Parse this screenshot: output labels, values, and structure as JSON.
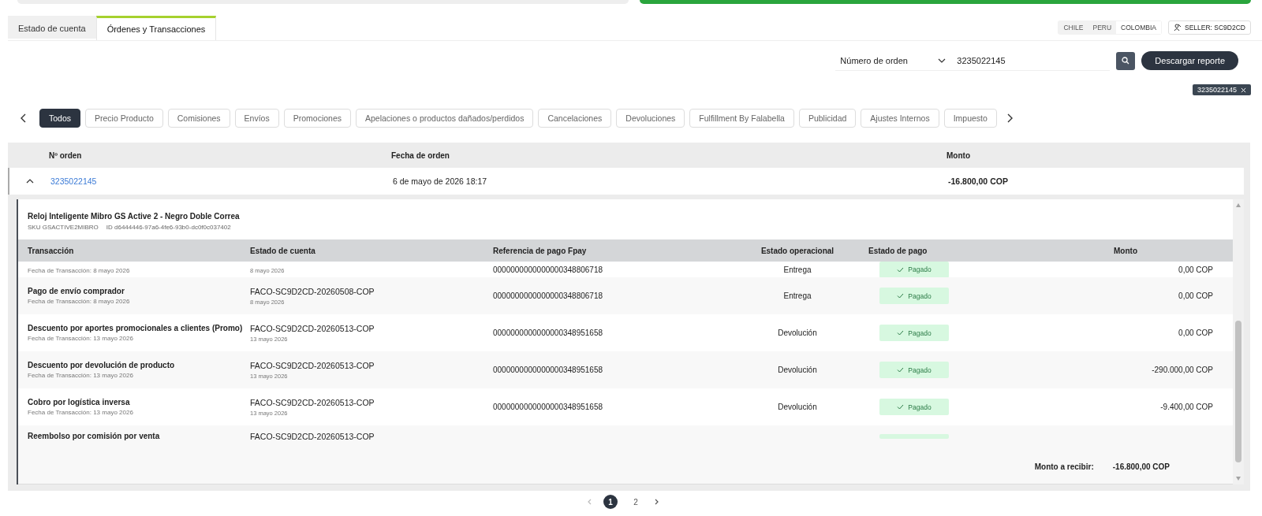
{
  "tabs": [
    {
      "label": "Estado de cuenta",
      "selected": false
    },
    {
      "label": "Órdenes y Transacciones",
      "selected": true
    }
  ],
  "countries": [
    {
      "label": "CHILE",
      "selected": false
    },
    {
      "label": "PERU",
      "selected": false
    },
    {
      "label": "COLOMBIA",
      "selected": true
    }
  ],
  "seller": "SELLER: SC9D2CD",
  "search": {
    "filter": "Número de orden",
    "value": "3235022145"
  },
  "download_button": "Descargar reporte",
  "active_filter_chip": "3235022145",
  "categories": [
    {
      "label": "Todos",
      "selected": true
    },
    {
      "label": "Precio Producto",
      "selected": false
    },
    {
      "label": "Comisiones",
      "selected": false
    },
    {
      "label": "Envíos",
      "selected": false
    },
    {
      "label": "Promociones",
      "selected": false
    },
    {
      "label": "Apelaciones o productos dañados/perdidos",
      "selected": false
    },
    {
      "label": "Cancelaciones",
      "selected": false
    },
    {
      "label": "Devoluciones",
      "selected": false
    },
    {
      "label": "Fulfillment By Falabella",
      "selected": false
    },
    {
      "label": "Publicidad",
      "selected": false
    },
    {
      "label": "Ajustes Internos",
      "selected": false
    },
    {
      "label": "Impuesto",
      "selected": false
    }
  ],
  "orders_table": {
    "columns": [
      "Nº orden",
      "Fecha de orden",
      "Monto"
    ],
    "rows": [
      {
        "order": "3235022145",
        "date": "6 de mayo de 2026 18:17",
        "amount": "-16.800,00 COP",
        "expanded": true,
        "product": {
          "name": "Reloj Inteligente Mibro GS Active 2 - Negro Doble Correa",
          "sku": "SKU GSACTIVE2MIBRO",
          "id": "ID d6444446-97a6-4fe6-93b0-dc0f0c037402"
        },
        "transactions": {
          "columns": [
            "Transacción",
            "Estado de cuenta",
            "Referencia de pago Fpay",
            "Estado operacional",
            "Estado de pago",
            "Monto"
          ],
          "rows": [
            {
              "title": "",
              "date": "Fecha de Transacción: 8 mayo 2026",
              "statement": "",
              "statement_date": "8 mayo 2026",
              "reference": "0000000000000000348806718",
              "operational": "Entrega",
              "payment": "Pagado",
              "amount": "0,00 COP"
            },
            {
              "title": "Pago de envío comprador",
              "date": "Fecha de Transacción: 8 mayo 2026",
              "statement": "FACO-SC9D2CD-20260508-COP",
              "statement_date": "8 mayo 2026",
              "reference": "0000000000000000348806718",
              "operational": "Entrega",
              "payment": "Pagado",
              "amount": "0,00 COP"
            },
            {
              "title": "Descuento por aportes promocionales a clientes (Promo)",
              "date": "Fecha de Transacción: 13 mayo 2026",
              "statement": "FACO-SC9D2CD-20260513-COP",
              "statement_date": "13 mayo 2026",
              "reference": "0000000000000000348951658",
              "operational": "Devolución",
              "payment": "Pagado",
              "amount": "0,00 COP"
            },
            {
              "title": "Descuento por devolución de producto",
              "date": "Fecha de Transacción: 13 mayo 2026",
              "statement": "FACO-SC9D2CD-20260513-COP",
              "statement_date": "13 mayo 2026",
              "reference": "0000000000000000348951658",
              "operational": "Devolución",
              "payment": "Pagado",
              "amount": "-290.000,00 COP"
            },
            {
              "title": "Cobro por logística inversa",
              "date": "Fecha de Transacción: 13 mayo 2026",
              "statement": "FACO-SC9D2CD-20260513-COP",
              "statement_date": "13 mayo 2026",
              "reference": "0000000000000000348951658",
              "operational": "Devolución",
              "payment": "Pagado",
              "amount": "-9.400,00 COP"
            },
            {
              "title": "Reembolso por comisión por venta",
              "date": "",
              "statement": "FACO-SC9D2CD-20260513-COP",
              "statement_date": "",
              "reference": "",
              "operational": "",
              "payment": "",
              "amount": ""
            }
          ]
        },
        "total_label": "Monto a recibir:",
        "total": "-16.800,00 COP"
      }
    ]
  },
  "pagination": [
    {
      "label": "1",
      "selected": true
    },
    {
      "label": "2",
      "selected": false
    }
  ]
}
